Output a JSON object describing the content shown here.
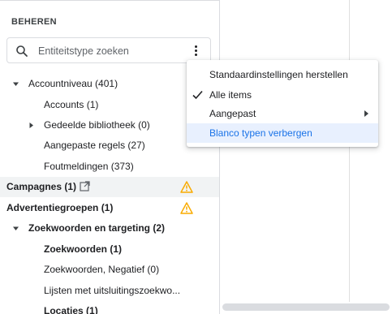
{
  "sidebar": {
    "section_title": "BEHEREN",
    "search": {
      "placeholder": "Entiteitstype zoeken",
      "value": ""
    },
    "items": [
      {
        "label": "Accountniveau (401)",
        "expanded": true
      },
      {
        "label": "Accounts (1)"
      },
      {
        "label": "Gedeelde bibliotheek (0)",
        "expanded": false
      },
      {
        "label": "Aangepaste regels (27)"
      },
      {
        "label": "Foutmeldingen (373)"
      },
      {
        "label": "Campagnes (1)",
        "selected": true,
        "warning": true
      },
      {
        "label": "Advertentiegroepen (1)",
        "warning": true
      },
      {
        "label": "Zoekwoorden en targeting (2)",
        "expanded": true
      },
      {
        "label": "Zoekwoorden (1)"
      },
      {
        "label": "Zoekwoorden, Negatief (0)"
      },
      {
        "label": "Lijsten met uitsluitingszoekwo..."
      },
      {
        "label": "Locaties (1)"
      }
    ]
  },
  "menu": {
    "items": [
      {
        "label": "Standaardinstellingen herstellen"
      },
      {
        "label": "Alle items",
        "checked": true
      },
      {
        "label": "Aangepast",
        "has_submenu": true
      },
      {
        "label": "Blanco typen verbergen",
        "highlighted": true
      }
    ]
  },
  "colors": {
    "accent": "#1a73e8",
    "warning": "#f9ab00",
    "selected_row": "#f1f3f4",
    "highlight": "#e8f0fe"
  }
}
